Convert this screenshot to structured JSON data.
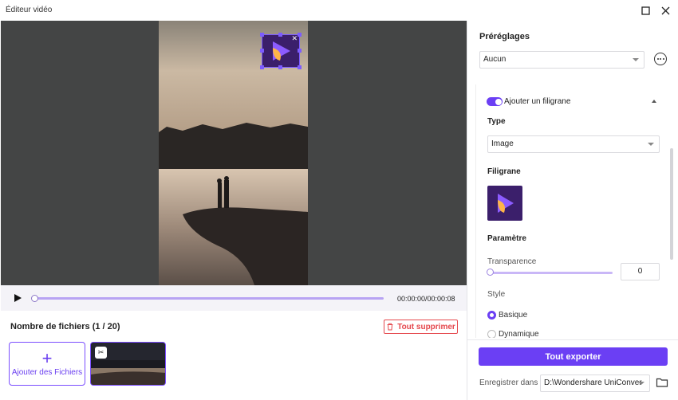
{
  "window": {
    "title": "Éditeur vidéo"
  },
  "player": {
    "time": "00:00:00/00:00:08",
    "progress": 0
  },
  "files": {
    "title": "Nombre de fichiers (1 / 20)",
    "delete_all_label": "Tout supprimer",
    "add_label": "Ajouter des Fichiers"
  },
  "panel": {
    "presets_title": "Préréglages",
    "presets_value": "Aucun",
    "watermark_toggle_label": "Ajouter un filigrane",
    "watermark_enabled": true,
    "type_title": "Type",
    "type_value": "Image",
    "filigrane_title": "Filigrane",
    "param_title": "Paramètre",
    "transparence_label": "Transparence",
    "transparence_value": "0",
    "style_label": "Style",
    "style_options": [
      "Basique",
      "Dynamique"
    ],
    "style_selected": "Basique",
    "export_label": "Tout exporter",
    "save_label": "Enregistrer dans",
    "save_path": "D:\\Wondershare UniConver"
  },
  "colors": {
    "accent": "#6b3ff4",
    "danger": "#e5484d",
    "preview_bg": "#444545"
  }
}
